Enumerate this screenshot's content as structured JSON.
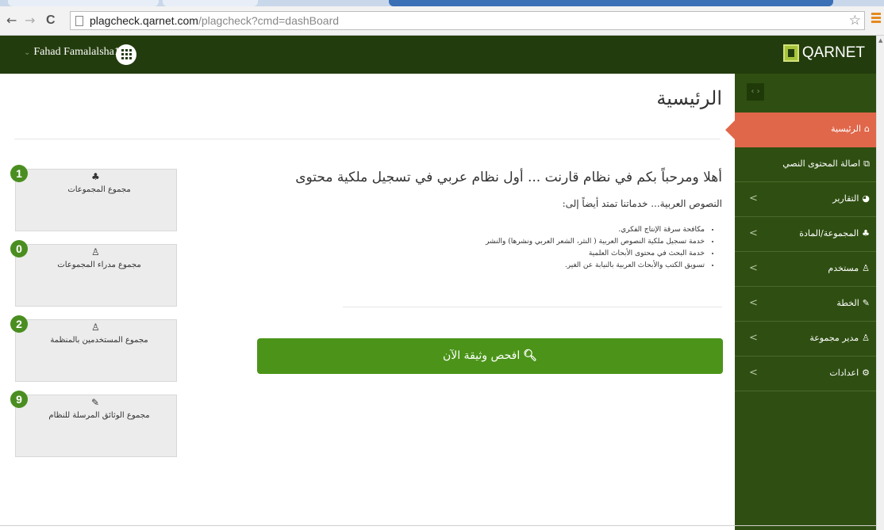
{
  "browser": {
    "back_glyph": "←",
    "forward_glyph": "→",
    "reload_glyph": "C",
    "url_host": "plagcheck.qarnet.com",
    "url_path": "/plagcheck?cmd=dashBoard",
    "star_glyph": "☆"
  },
  "header": {
    "chevron_glyph": "⌄",
    "user_name": "Fahad Famalalsha1",
    "brand_name": "QARNET"
  },
  "sidebar": {
    "collapse_glyph": "‹ ›",
    "items": [
      {
        "label": "الرئيسية",
        "icon": "⌂",
        "icon_name": "home-icon",
        "active": true,
        "has_arrow": false
      },
      {
        "label": "اصالة المحتوى النصي",
        "icon": "⧉",
        "icon_name": "copy-docs-icon",
        "active": false,
        "has_arrow": false
      },
      {
        "label": "التقارير",
        "icon": "◕",
        "icon_name": "pie-chart-icon",
        "active": false,
        "has_arrow": true
      },
      {
        "label": "المجموعة/المادة",
        "icon": "♣",
        "icon_name": "users-group-icon",
        "active": false,
        "has_arrow": true
      },
      {
        "label": "مستخدم",
        "icon": "♙",
        "icon_name": "user-icon",
        "active": false,
        "has_arrow": true
      },
      {
        "label": "الخطة",
        "icon": "✎",
        "icon_name": "edit-icon",
        "active": false,
        "has_arrow": true
      },
      {
        "label": "مدير مجموعة",
        "icon": "♙",
        "icon_name": "group-manager-icon",
        "active": false,
        "has_arrow": true
      },
      {
        "label": "اعدادات",
        "icon": "⚙",
        "icon_name": "gear-icon",
        "active": false,
        "has_arrow": true
      }
    ],
    "arrow_glyph": "<"
  },
  "main": {
    "page_title": "الرئيسية",
    "welcome_line": "أهلا ومرحباً بكم في نظام قارنت ... أول نظام عربي في تسجيل ملكية محتوى",
    "welcome_sub": "النصوص العربية... خدماتنا تمتد أيضاً إلى:",
    "services": [
      "مكافحة سرقة الإنتاج الفكري.",
      "خدمة تسجيل ملكية النصوص العربية ( النثر، الشعر العربي ونشرها) والنشر",
      "خدمة البحث في محتوى الأبحاث العلمية",
      "تسويق الكتب والأبحاث العربية بالنيابة عن الغير."
    ],
    "check_button": "افحص وثيقة الآن",
    "check_icon": "🔍︎"
  },
  "stats": [
    {
      "count": "1",
      "icon": "♣",
      "icon_name": "users-group-icon",
      "label": "مجموع المجموعات"
    },
    {
      "count": "0",
      "icon": "♙",
      "icon_name": "user-icon",
      "label": "مجموع مدراء المجموعات"
    },
    {
      "count": "2",
      "icon": "♙",
      "icon_name": "user-icon",
      "label": "مجموع المستخدمين بالمنظمة"
    },
    {
      "count": "9",
      "icon": "✎",
      "icon_name": "edit-icon",
      "label": "مجموع الوثائق المرسلة للنظام"
    }
  ]
}
